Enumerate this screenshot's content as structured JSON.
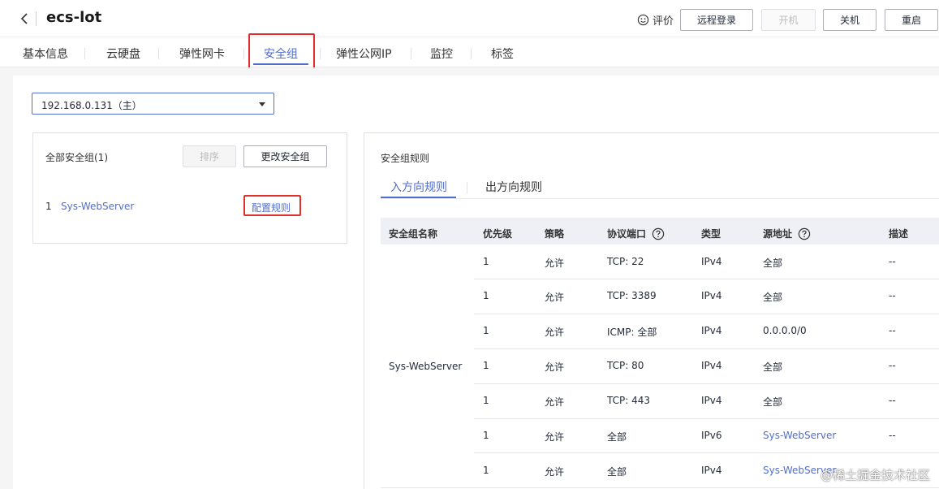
{
  "header": {
    "title": "ecs-lot",
    "rate_label": "评价",
    "buttons": {
      "remote_login": "远程登录",
      "power_on": "开机",
      "power_off": "关机",
      "restart": "重启"
    }
  },
  "tabs": [
    {
      "label": "基本信息"
    },
    {
      "label": "云硬盘"
    },
    {
      "label": "弹性网卡"
    },
    {
      "label": "安全组",
      "active": true
    },
    {
      "label": "弹性公网IP"
    },
    {
      "label": "监控"
    },
    {
      "label": "标签"
    }
  ],
  "nic_select": {
    "value": "192.168.0.131（主）"
  },
  "left_panel": {
    "title": "全部安全组(1)",
    "sort_button": "排序",
    "change_button": "更改安全组",
    "items": [
      {
        "index": "1",
        "name": "Sys-WebServer",
        "action": "配置规则"
      }
    ]
  },
  "rules_panel": {
    "title": "安全组规则",
    "subtabs": [
      {
        "label": "入方向规则",
        "active": true
      },
      {
        "label": "出方向规则"
      }
    ],
    "columns": [
      "安全组名称",
      "优先级",
      "策略",
      "协议端口",
      "类型",
      "源地址",
      "描述"
    ],
    "group_name": "Sys-WebServer",
    "rows": [
      {
        "priority": "1",
        "policy": "允许",
        "port": "TCP: 22",
        "type": "IPv4",
        "source": "全部",
        "desc": "--"
      },
      {
        "priority": "1",
        "policy": "允许",
        "port": "TCP: 3389",
        "type": "IPv4",
        "source": "全部",
        "desc": "--"
      },
      {
        "priority": "1",
        "policy": "允许",
        "port": "ICMP: 全部",
        "type": "IPv4",
        "source": "0.0.0.0/0",
        "desc": "--"
      },
      {
        "priority": "1",
        "policy": "允许",
        "port": "TCP: 80",
        "type": "IPv4",
        "source": "全部",
        "desc": "--"
      },
      {
        "priority": "1",
        "policy": "允许",
        "port": "TCP: 443",
        "type": "IPv4",
        "source": "全部",
        "desc": "--"
      },
      {
        "priority": "1",
        "policy": "允许",
        "port": "全部",
        "type": "IPv6",
        "source": "Sys-WebServer",
        "desc": "--"
      },
      {
        "priority": "1",
        "policy": "允许",
        "port": "全部",
        "type": "IPv4",
        "source": "Sys-WebServer",
        "desc": ""
      }
    ]
  },
  "watermark": "@稀土掘金技术社区",
  "colors": {
    "accent": "#526ecc",
    "highlight": "#e0302a"
  }
}
